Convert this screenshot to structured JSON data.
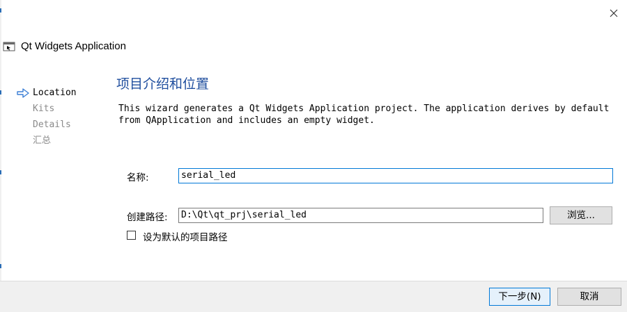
{
  "window": {
    "title": "Qt Widgets Application"
  },
  "steps": [
    {
      "label": "Location",
      "active": true
    },
    {
      "label": "Kits",
      "active": false
    },
    {
      "label": "Details",
      "active": false
    },
    {
      "label": "汇总",
      "active": false
    }
  ],
  "page": {
    "title": "项目介绍和位置",
    "description": "This wizard generates a Qt Widgets Application project. The application derives by default\nfrom QApplication and includes an empty widget."
  },
  "form": {
    "name_label": "名称:",
    "name_value": "serial_led",
    "path_label": "创建路径:",
    "path_value": "D:\\Qt\\qt_prj\\serial_led",
    "browse_label": "浏览...",
    "default_path_label": "设为默认的项目路径",
    "default_path_checked": false
  },
  "footer": {
    "next_label": "下一步(N)",
    "cancel_label": "取消"
  },
  "colors": {
    "accent": "#0078d7",
    "title": "#1f4e9e",
    "step_arrow": "#3c7fd6"
  },
  "icons": {
    "close": "close-icon",
    "app": "qt-app-icon",
    "current_step": "right-arrow-icon"
  }
}
